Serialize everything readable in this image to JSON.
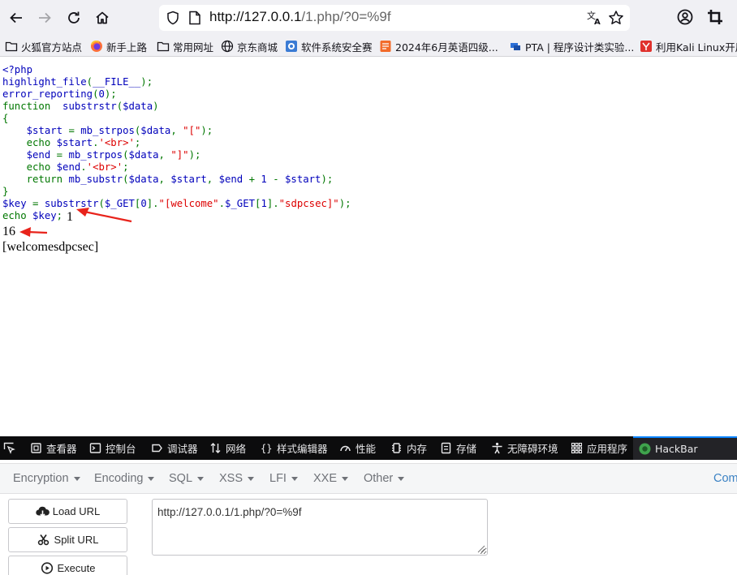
{
  "browser": {
    "url_host": "http://127.0.0.1",
    "url_rest": "/1.php/?0=%9f",
    "bookmarks": [
      "火狐官方站点",
      "新手上路",
      "常用网址",
      "京东商城",
      "软件系统安全赛",
      "2024年6月英语四级...",
      "PTA | 程序设计类实验...",
      "利用Kali Linux开展"
    ]
  },
  "source": {
    "l1": "<?php",
    "l2a": "highlight_file",
    "l2b": "(",
    "l2c": "__FILE__",
    "l2d": ");",
    "l3a": "error_reporting",
    "l3b": "(",
    "l3c": "0",
    "l3d": ");",
    "l4a": "function ",
    "l4b": "substrstr",
    "l4c": "(",
    "l4d": "$data",
    "l4e": ")",
    "l5": "{",
    "l6a": "    $start ",
    "l6b": "= ",
    "l6c": "mb_strpos",
    "l6d": "(",
    "l6e": "$data",
    "l6f": ", ",
    "l6g": "\"[\"",
    "l6h": ");",
    "l7a": "    echo ",
    "l7b": "$start",
    "l7c": ".",
    "l7d": "'<br>'",
    "l7e": ";",
    "l8a": "    $end ",
    "l8b": "= ",
    "l8c": "mb_strpos",
    "l8d": "(",
    "l8e": "$data",
    "l8f": ", ",
    "l8g": "\"]\"",
    "l8h": ");",
    "l9a": "    echo ",
    "l9b": "$end",
    "l9c": ".",
    "l9d": "'<br>'",
    "l9e": ";",
    "l10a": "    return ",
    "l10b": "mb_substr",
    "l10c": "(",
    "l10d": "$data",
    "l10e": ", ",
    "l10f": "$start",
    "l10g": ", ",
    "l10h": "$end ",
    "l10i": "+ ",
    "l10j": "1 ",
    "l10k": "- ",
    "l10l": "$start",
    "l10m": ");",
    "l11": "}",
    "l12a": "$key ",
    "l12b": "= ",
    "l12c": "substrstr",
    "l12d": "(",
    "l12e": "$_GET",
    "l12f": "[",
    "l12g": "0",
    "l12h": "].",
    "l12i": "\"[welcome\"",
    "l12j": ".",
    "l12k": "$_GET",
    "l12l": "[",
    "l12m": "1",
    "l12n": "].",
    "l12o": "\"sdpcsec]\"",
    "l12p": ");",
    "l13a": "echo ",
    "l13b": "$key",
    "l13c": ";"
  },
  "output": {
    "start": "1",
    "end": "16",
    "key": "[welcomesdpcsec]"
  },
  "devtools": {
    "tabs": [
      "查看器",
      "控制台",
      "调试器",
      "网络",
      "样式编辑器",
      "性能",
      "内存",
      "存储",
      "无障碍环境",
      "应用程序",
      "HackBar"
    ]
  },
  "hackbar": {
    "menus": [
      "Encryption",
      "Encoding",
      "SQL",
      "XSS",
      "LFI",
      "XXE",
      "Other"
    ],
    "more": "Com",
    "buttons": [
      "Load URL",
      "Split URL",
      "Execute"
    ],
    "url_value": "http://127.0.0.1/1.php/?0=%9f"
  },
  "colors": {
    "php_keyword": "#007700",
    "php_string": "#dd0000",
    "php_default": "#0000bb",
    "annotation_arrow": "#e8231b",
    "devtools_bg": "#0c0c0d",
    "active_tab": "#0a84ff"
  }
}
